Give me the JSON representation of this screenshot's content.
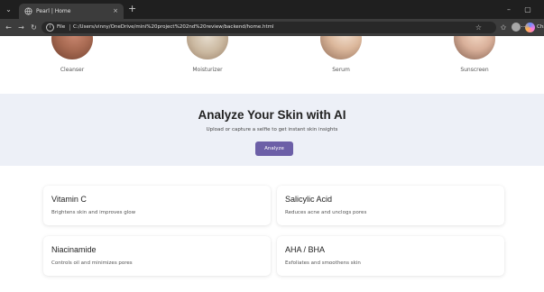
{
  "browser": {
    "tab_title": "Pearl | Home",
    "tab_close": "×",
    "new_tab": "+",
    "tab_list": "⌄",
    "minimize": "–",
    "maximize": "▢",
    "nav": {
      "back": "←",
      "forward": "→",
      "reload": "↻"
    },
    "address_bar": {
      "scheme_label": "File",
      "url": "C:/Users/vinny/OneDrive/mini%20project%202nd%20review/backend/home.html"
    },
    "chat_label": "Chat"
  },
  "page": {
    "products": [
      {
        "label": "Cleanser"
      },
      {
        "label": "Moisturizer"
      },
      {
        "label": "Serum"
      },
      {
        "label": "Sunscreen"
      }
    ],
    "hero": {
      "title": "Analyze Your Skin with AI",
      "subtitle": "Upload or capture a selfie to get instant skin insights",
      "button_label": "Analyze"
    },
    "ingredients": [
      {
        "title": "Vitamin C",
        "description": "Brightens skin and improves glow"
      },
      {
        "title": "Salicylic Acid",
        "description": "Reduces acne and unclogs pores"
      },
      {
        "title": "Niacinamide",
        "description": "Controls oil and minimizes pores"
      },
      {
        "title": "AHA / BHA",
        "description": "Exfoliates and smoothens skin"
      }
    ]
  },
  "colors": {
    "accent": "#6c5fa7",
    "hero_background": "#edf0f7",
    "chrome_dark": "#1f1f1f",
    "chrome_toolbar": "#3c3c3c"
  }
}
